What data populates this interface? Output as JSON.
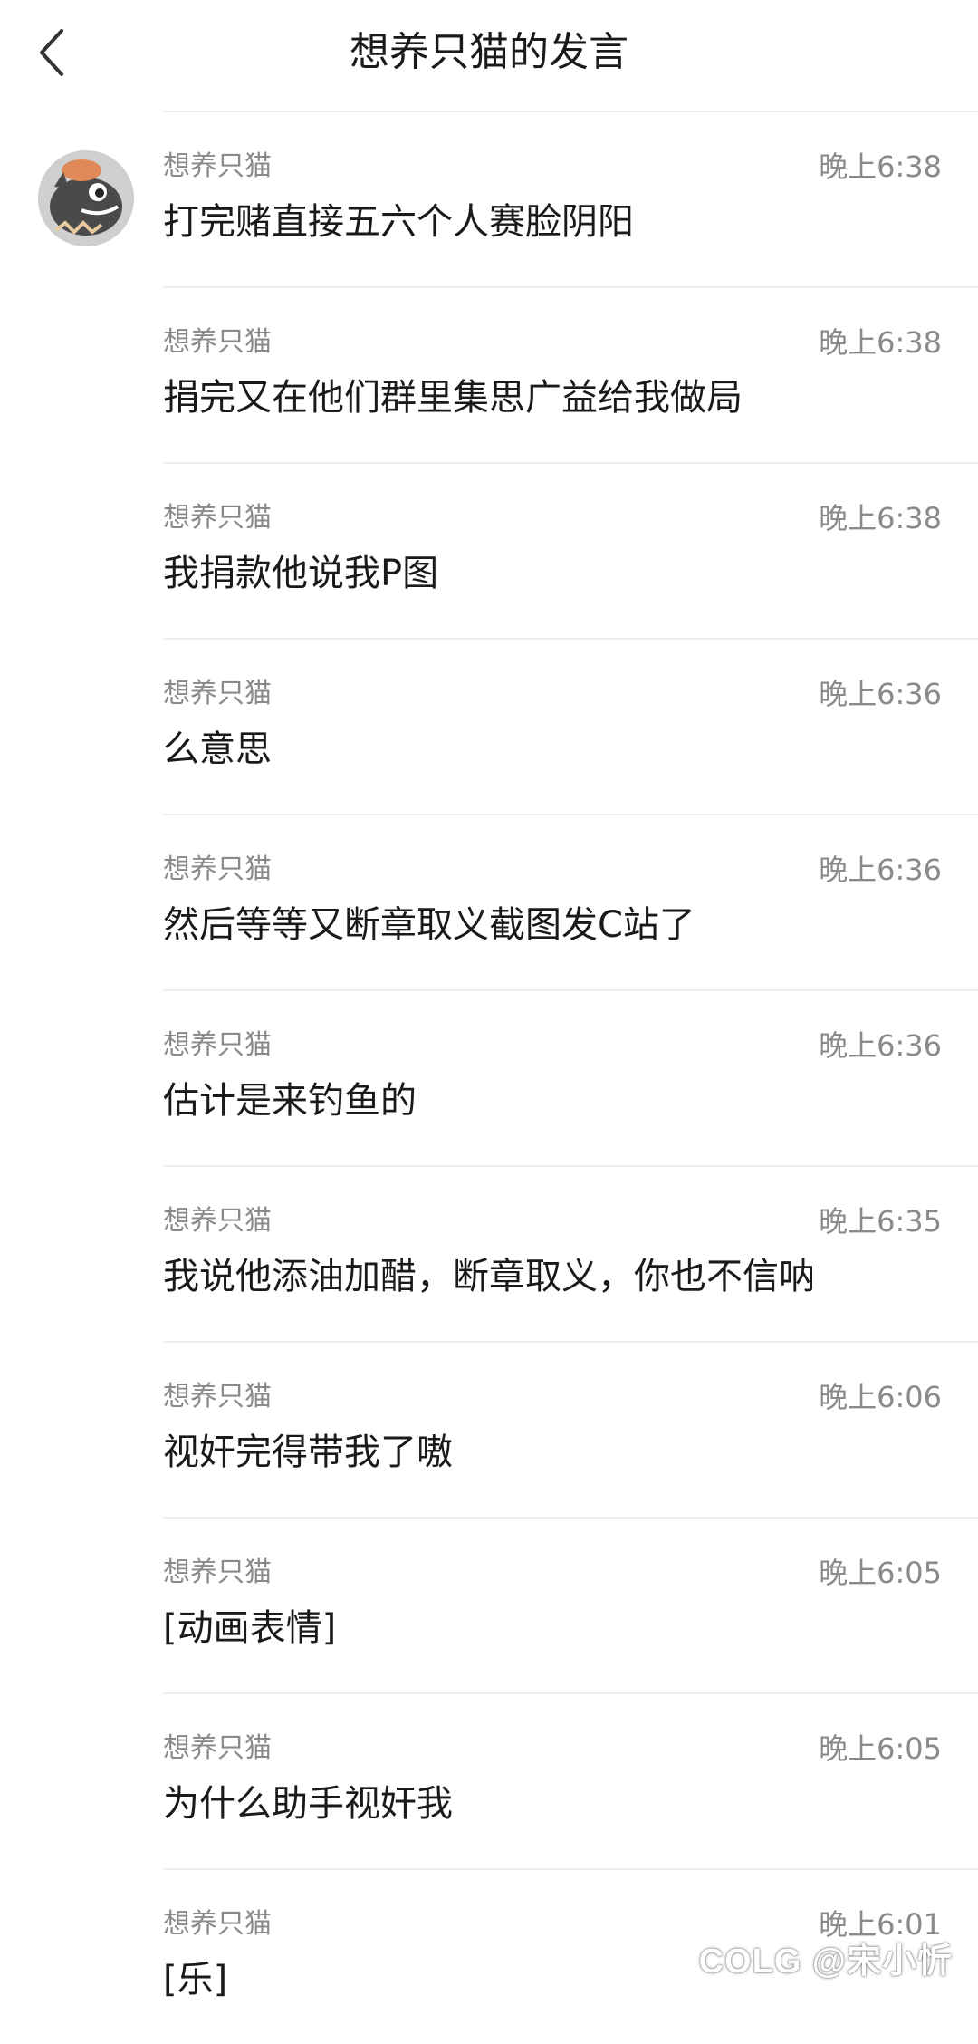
{
  "header": {
    "title": "想养只猫的发言",
    "back_icon": "chevron-left-icon"
  },
  "messages": [
    {
      "name": "想养只猫",
      "time": "晚上6:38",
      "text": "打完赌直接五六个人赛脸阴阳",
      "show_avatar": true
    },
    {
      "name": "想养只猫",
      "time": "晚上6:38",
      "text": "捐完又在他们群里集思广益给我做局",
      "show_avatar": false
    },
    {
      "name": "想养只猫",
      "time": "晚上6:38",
      "text": "我捐款他说我P图",
      "show_avatar": false
    },
    {
      "name": "想养只猫",
      "time": "晚上6:36",
      "text": "么意思",
      "show_avatar": false
    },
    {
      "name": "想养只猫",
      "time": "晚上6:36",
      "text": "然后等等又断章取义截图发C站了",
      "show_avatar": false
    },
    {
      "name": "想养只猫",
      "time": "晚上6:36",
      "text": "估计是来钓鱼的",
      "show_avatar": false
    },
    {
      "name": "想养只猫",
      "time": "晚上6:35",
      "text": "我说他添油加醋，断章取义，你也不信呐",
      "show_avatar": false
    },
    {
      "name": "想养只猫",
      "time": "晚上6:06",
      "text": "视奸完得带我了嗷",
      "show_avatar": false
    },
    {
      "name": "想养只猫",
      "time": "晚上6:05",
      "text": "[动画表情]",
      "show_avatar": false
    },
    {
      "name": "想养只猫",
      "time": "晚上6:05",
      "text": "为什么助手视奸我",
      "show_avatar": false
    },
    {
      "name": "想养只猫",
      "time": "晚上6:01",
      "text": "[乐]",
      "show_avatar": false
    }
  ],
  "watermark": "COLG @宋小忻",
  "colors": {
    "background": "#ffffff",
    "text_primary": "#1a1a1a",
    "text_secondary": "#8a8a8a",
    "separator": "#f0f0f0"
  }
}
